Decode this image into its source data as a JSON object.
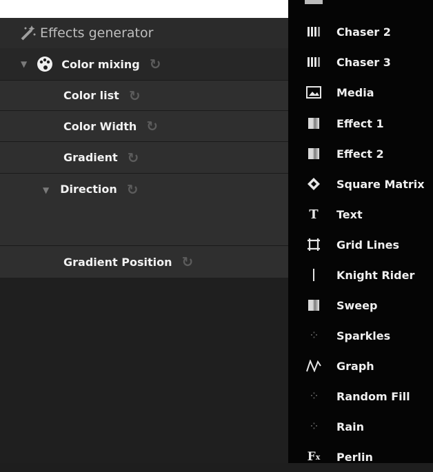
{
  "header": {
    "title": "Effects generator"
  },
  "tree": {
    "root": {
      "label": "Color mixing"
    },
    "items": [
      {
        "label": "Color list"
      },
      {
        "label": "Color Width"
      },
      {
        "label": "Gradient"
      },
      {
        "label": "Direction"
      },
      {
        "label": "Gradient Position"
      }
    ]
  },
  "menu": {
    "items": [
      {
        "label": "Chaser 2",
        "icon": "chaser-icon"
      },
      {
        "label": "Chaser 3",
        "icon": "chaser-icon"
      },
      {
        "label": "Media",
        "icon": "media-icon"
      },
      {
        "label": "Effect 1",
        "icon": "effect-icon"
      },
      {
        "label": "Effect 2",
        "icon": "effect-icon"
      },
      {
        "label": "Square Matrix",
        "icon": "diamond-icon"
      },
      {
        "label": "Text",
        "icon": "text-icon"
      },
      {
        "label": "Grid Lines",
        "icon": "grid-lines-icon"
      },
      {
        "label": "Knight Rider",
        "icon": "knight-rider-icon"
      },
      {
        "label": "Sweep",
        "icon": "sweep-icon"
      },
      {
        "label": "Sparkles",
        "icon": "sparkles-icon"
      },
      {
        "label": "Graph",
        "icon": "graph-icon"
      },
      {
        "label": "Random Fill",
        "icon": "random-fill-icon"
      },
      {
        "label": "Rain",
        "icon": "rain-icon"
      },
      {
        "label": "Perlin",
        "icon": "perlin-icon"
      }
    ]
  }
}
